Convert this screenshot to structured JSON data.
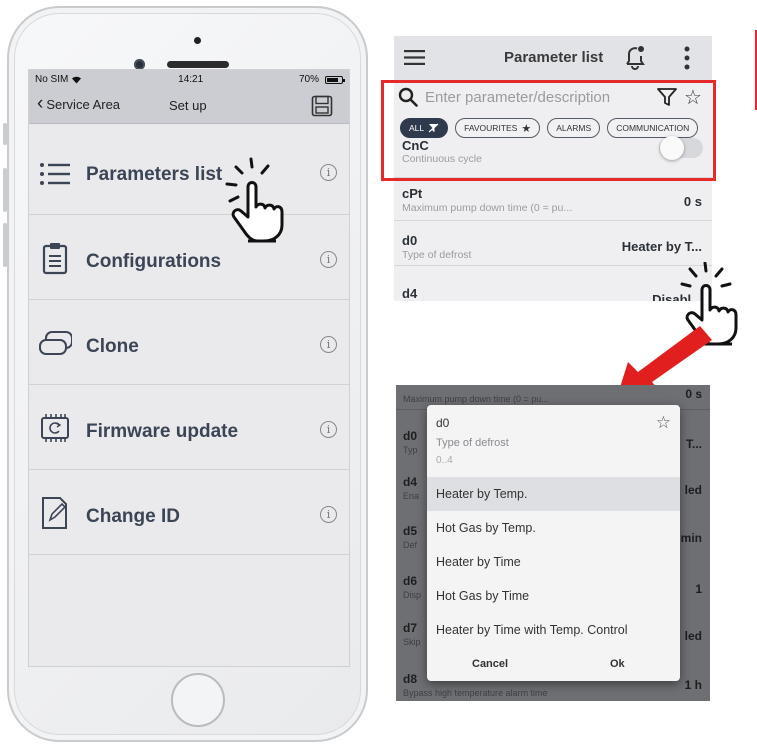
{
  "phone": {
    "status": {
      "carrier": "No SIM",
      "time": "14:21",
      "battery": "70%"
    },
    "nav": {
      "back_label": "Service Area",
      "title": "Set up"
    },
    "menu": [
      {
        "label": "Parameters list",
        "icon": "list-icon"
      },
      {
        "label": "Configurations",
        "icon": "clipboard-icon"
      },
      {
        "label": "Clone",
        "icon": "clone-icon"
      },
      {
        "label": "Firmware update",
        "icon": "chip-icon"
      },
      {
        "label": "Change ID",
        "icon": "edit-document-icon"
      }
    ],
    "info_glyph": "i"
  },
  "param_list": {
    "title": "Parameter list",
    "search_placeholder": "Enter parameter/description",
    "chips": [
      "ALL",
      "FAVOURITES",
      "ALARMS",
      "COMMUNICATION"
    ],
    "rows": [
      {
        "code": "CnC",
        "desc": "Continuous cycle",
        "value": ""
      },
      {
        "code": "cPt",
        "desc": "Maximum pump down time (0 = pu...",
        "value": "0 s"
      },
      {
        "code": "d0",
        "desc": "Type of defrost",
        "value": "Heater by T..."
      },
      {
        "code": "d4",
        "desc": "",
        "value": "Disabl..."
      }
    ]
  },
  "dialog": {
    "background": {
      "top_desc": "Maximum pump down time (0 = pu...",
      "rows": [
        {
          "code": "d0",
          "sub": "Typ",
          "value": "T..."
        },
        {
          "code": "d4",
          "sub": "Ena",
          "value": "led"
        },
        {
          "code": "d5",
          "sub": "Def",
          "value": "min"
        },
        {
          "code": "d6",
          "sub": "Disp",
          "value": "1"
        },
        {
          "code": "d7",
          "sub": "Skip",
          "value": "led"
        },
        {
          "code": "d8",
          "sub": "Bypass high temperature alarm time",
          "value": "1 h"
        }
      ]
    },
    "code": "d0",
    "type": "Type of defrost",
    "range": "0..4",
    "options": [
      "Heater by Temp.",
      "Hot Gas by Temp.",
      "Heater by Time",
      "Hot Gas by Time",
      "Heater by Time with Temp. Control"
    ],
    "selected_index": 0,
    "cancel_label": "Cancel",
    "ok_label": "Ok"
  },
  "colors": {
    "highlight": "#e62a2a",
    "chip_active": "#2f3a4f",
    "menu_text": "#3c4555"
  }
}
